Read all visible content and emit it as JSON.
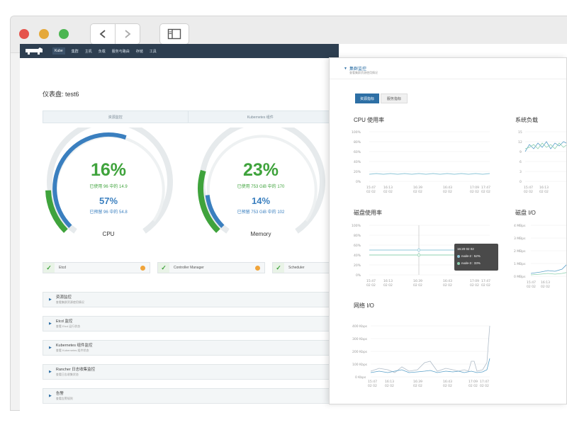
{
  "navbar": {
    "items": [
      "Kube",
      "集群",
      "主机",
      "负载",
      "服务与路由",
      "存储",
      "工具"
    ]
  },
  "dashboard": {
    "title": "仪表盘: test6",
    "tabs": [
      "资源监控",
      "Kubernetes 组件"
    ]
  },
  "gauges": {
    "cpu": {
      "main_pct": "16%",
      "main_text": "已使用 96 中的 14.9",
      "sub_pct": "57%",
      "sub_text": "已预留 96 中的 54.8",
      "label": "CPU",
      "main_value": 0.16,
      "sub_value": 0.57
    },
    "memory": {
      "main_pct": "23%",
      "main_text": "已使用 753 GiB 中的 170",
      "sub_pct": "14%",
      "sub_text": "已预留 753 GiB 中的 102",
      "label": "Memory",
      "main_value": 0.23,
      "sub_value": 0.14
    }
  },
  "status": [
    "Etcd",
    "Controller Manager",
    "Scheduler"
  ],
  "panels": [
    {
      "title": "资源监控",
      "sub": "查看集群资源使用情况"
    },
    {
      "title": "Etcd 监控",
      "sub": "查看 Etcd 运行状态"
    },
    {
      "title": "Kubernetes 组件监控",
      "sub": "查看 Kubernetes 组件状态"
    },
    {
      "title": "Rancher 日志收集监控",
      "sub": "查看日志收集状态"
    },
    {
      "title": "告警",
      "sub": "查看告警规则"
    }
  ],
  "overlay": {
    "title": "集群监控",
    "subtitle": "查看集群资源使用情况",
    "btn_resource": "资源指标",
    "btn_service": "服务指标"
  },
  "charts": {
    "cpu_title": "CPU 使用率",
    "load_title": "系统负载",
    "disk_title": "磁盘使用率",
    "diskio_title": "磁盘 I/O",
    "net_title": "网络 I/O",
    "pct_ticks": [
      "100%",
      "80%",
      "60%",
      "40%",
      "20%",
      "0%"
    ],
    "net_ticks": [
      "400 Kbps",
      "300 Kbps",
      "200 Kbps",
      "100 Kbps",
      "0 Kbps"
    ],
    "diskio_ticks": [
      "4 MBps",
      "3 MBps",
      "2 MBps",
      "1 MBps",
      "0 MBps"
    ],
    "load_ticks": [
      "15",
      "12",
      "9",
      "6",
      "3",
      "0"
    ],
    "time_ticks": [
      "15:47",
      "16:13",
      "16:39",
      "16:43",
      "17:09",
      "17:47"
    ],
    "date_tick": "02 02"
  },
  "tooltip": {
    "time": "16:20 02 02",
    "line1": "node-2 : 52%",
    "line2": "node-3 : 33%"
  },
  "colors": {
    "green": "#3fa33c",
    "blue": "#3a7fbf",
    "navbar": "#2d3e50",
    "accent": "#2d6fa5"
  }
}
